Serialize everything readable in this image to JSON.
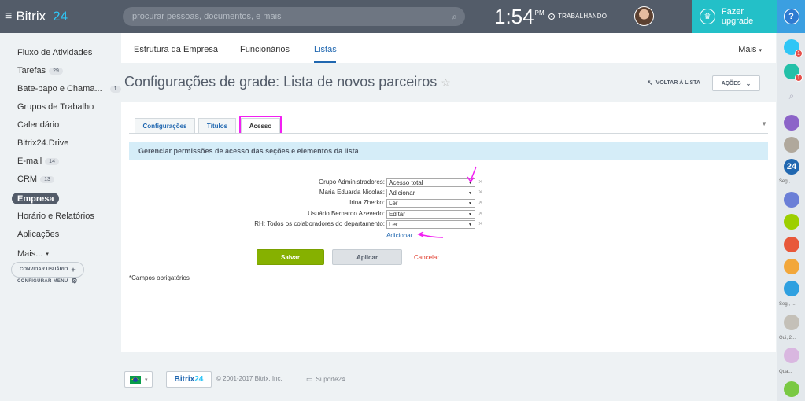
{
  "topbar": {
    "logo_text": "Bitrix",
    "logo_num": "24",
    "search_placeholder": "procurar pessoas, documentos, e mais",
    "clock": "1:54",
    "clock_ampm": "PM",
    "work_status": "TRABALHANDO",
    "upgrade_label": "Fazer upgrade",
    "help_label": "?"
  },
  "sidebar": {
    "items": [
      {
        "label": "Fluxo de Atividades",
        "count": ""
      },
      {
        "label": "Tarefas",
        "count": "29"
      },
      {
        "label": "Bate-papo e Chama...",
        "count": "1"
      },
      {
        "label": "Grupos de Trabalho",
        "count": ""
      },
      {
        "label": "Calendário",
        "count": ""
      },
      {
        "label": "Bitrix24.Drive",
        "count": ""
      },
      {
        "label": "E-mail",
        "count": "14"
      },
      {
        "label": "CRM",
        "count": "13"
      },
      {
        "label": "Empresa",
        "count": ""
      },
      {
        "label": "Horário e Relatórios",
        "count": ""
      },
      {
        "label": "Aplicações",
        "count": ""
      },
      {
        "label": "Mais...",
        "count": ""
      }
    ],
    "config_menu": "CONFIGURAR MENU",
    "invite_user": "CONVIDAR USUÁRIO"
  },
  "tabs": {
    "items": [
      "Estrutura da Empresa",
      "Funcionários",
      "Listas"
    ],
    "active": "Listas",
    "more": "Mais"
  },
  "page": {
    "title": "Configurações de grade: Lista de novos parceiros",
    "back_link": "VOLTAR À LISTA",
    "actions": "AÇÕES"
  },
  "inner_tabs": [
    "Configurações",
    "Títulos",
    "Acesso"
  ],
  "section_header": "Gerenciar permissões de acesso das seções e elementos da lista",
  "permissions": [
    {
      "who": "Grupo Administradores:",
      "value": "Acesso total"
    },
    {
      "who": "Maria Eduarda Nicolas:",
      "value": "Adicionar"
    },
    {
      "who": "Irina Zherko:",
      "value": "Ler"
    },
    {
      "who": "Usuário Bernardo Azevedo:",
      "value": "Editar"
    },
    {
      "who": "RH: Todos os colaboradores do departamento:",
      "value": "Ler"
    }
  ],
  "add_link": "Adicionar",
  "buttons": {
    "save": "Salvar",
    "apply": "Aplicar",
    "cancel": "Cancelar"
  },
  "required_note": "*Campos obrigatórios",
  "footer": {
    "brand": "Bitrix",
    "brand_num": "24",
    "copyright": "© 2001-2017 Bitrix, Inc.",
    "support": "Suporte24"
  },
  "right_panel": {
    "labels": [
      "Seg., ...",
      "Seg., ...",
      "Qui, 2...",
      "Qua..."
    ],
    "badge_count": "1",
    "b24_icon_text": "24"
  },
  "colors": {
    "topbar": "#535c69",
    "accent": "#2067b0",
    "upgrade": "#23c0c8",
    "save": "#86b100",
    "highlight": "#f21ff2"
  }
}
